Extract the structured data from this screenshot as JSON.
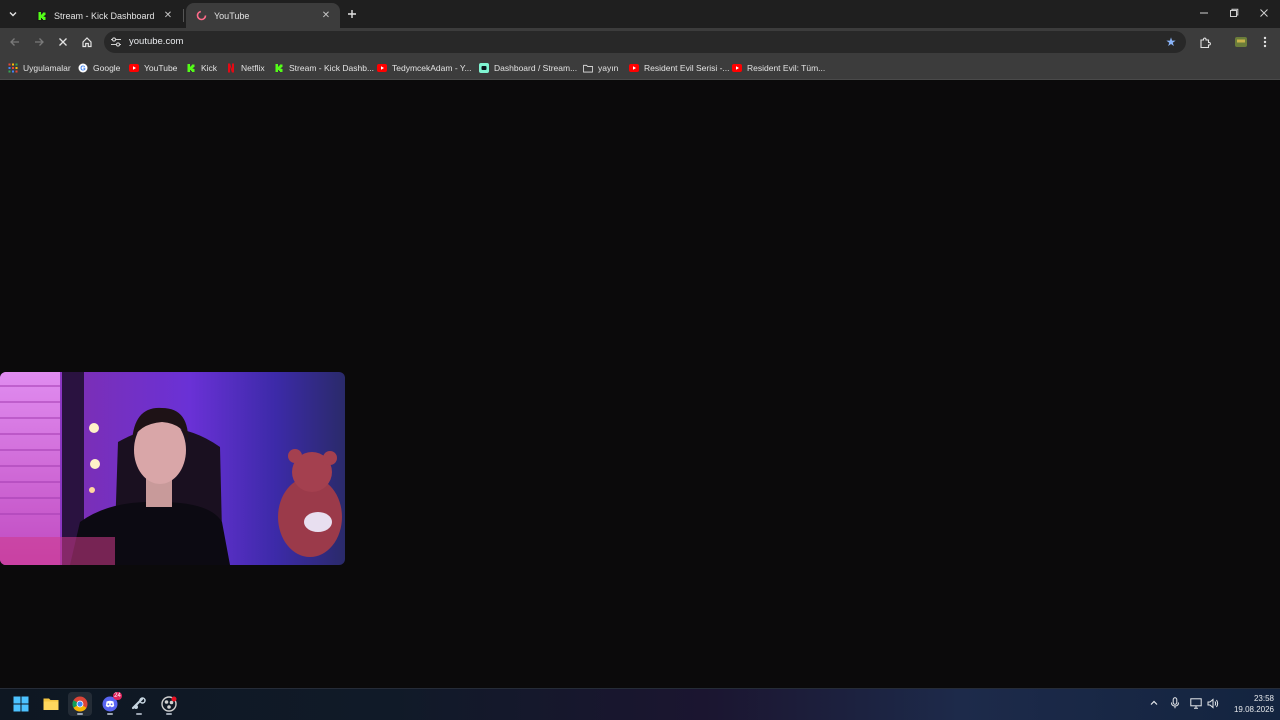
{
  "browser": {
    "tabs": [
      {
        "title": "Stream - Kick Dashboard",
        "active": false,
        "favicon": "kick-icon"
      },
      {
        "title": "YouTube",
        "active": true,
        "favicon": "loading-spinner-icon"
      }
    ],
    "address": "youtube.com",
    "bookmarks": [
      {
        "label": "Uygulamalar",
        "icon": "apps-grid-icon"
      },
      {
        "label": "Google",
        "icon": "google-icon"
      },
      {
        "label": "YouTube",
        "icon": "youtube-icon"
      },
      {
        "label": "Kick",
        "icon": "kick-icon"
      },
      {
        "label": "Netflix",
        "icon": "netflix-icon"
      },
      {
        "label": "Stream - Kick Dashb...",
        "icon": "kick-icon"
      },
      {
        "label": "TedymcekAdam - Y...",
        "icon": "youtube-icon"
      },
      {
        "label": "Dashboard / Stream...",
        "icon": "streamlabs-icon"
      },
      {
        "label": "yayın",
        "icon": "folder-icon"
      },
      {
        "label": "Resident Evil Serisi -...",
        "icon": "youtube-icon"
      },
      {
        "label": "Resident Evil: Tüm...",
        "icon": "youtube-icon"
      }
    ]
  },
  "taskbar": {
    "discord_badge": "24",
    "time": "23:58",
    "date": "19.08.2026"
  },
  "colors": {
    "kick_green": "#53fc18",
    "youtube_red": "#ff0000",
    "accent_blue": "#8ab4f8"
  }
}
